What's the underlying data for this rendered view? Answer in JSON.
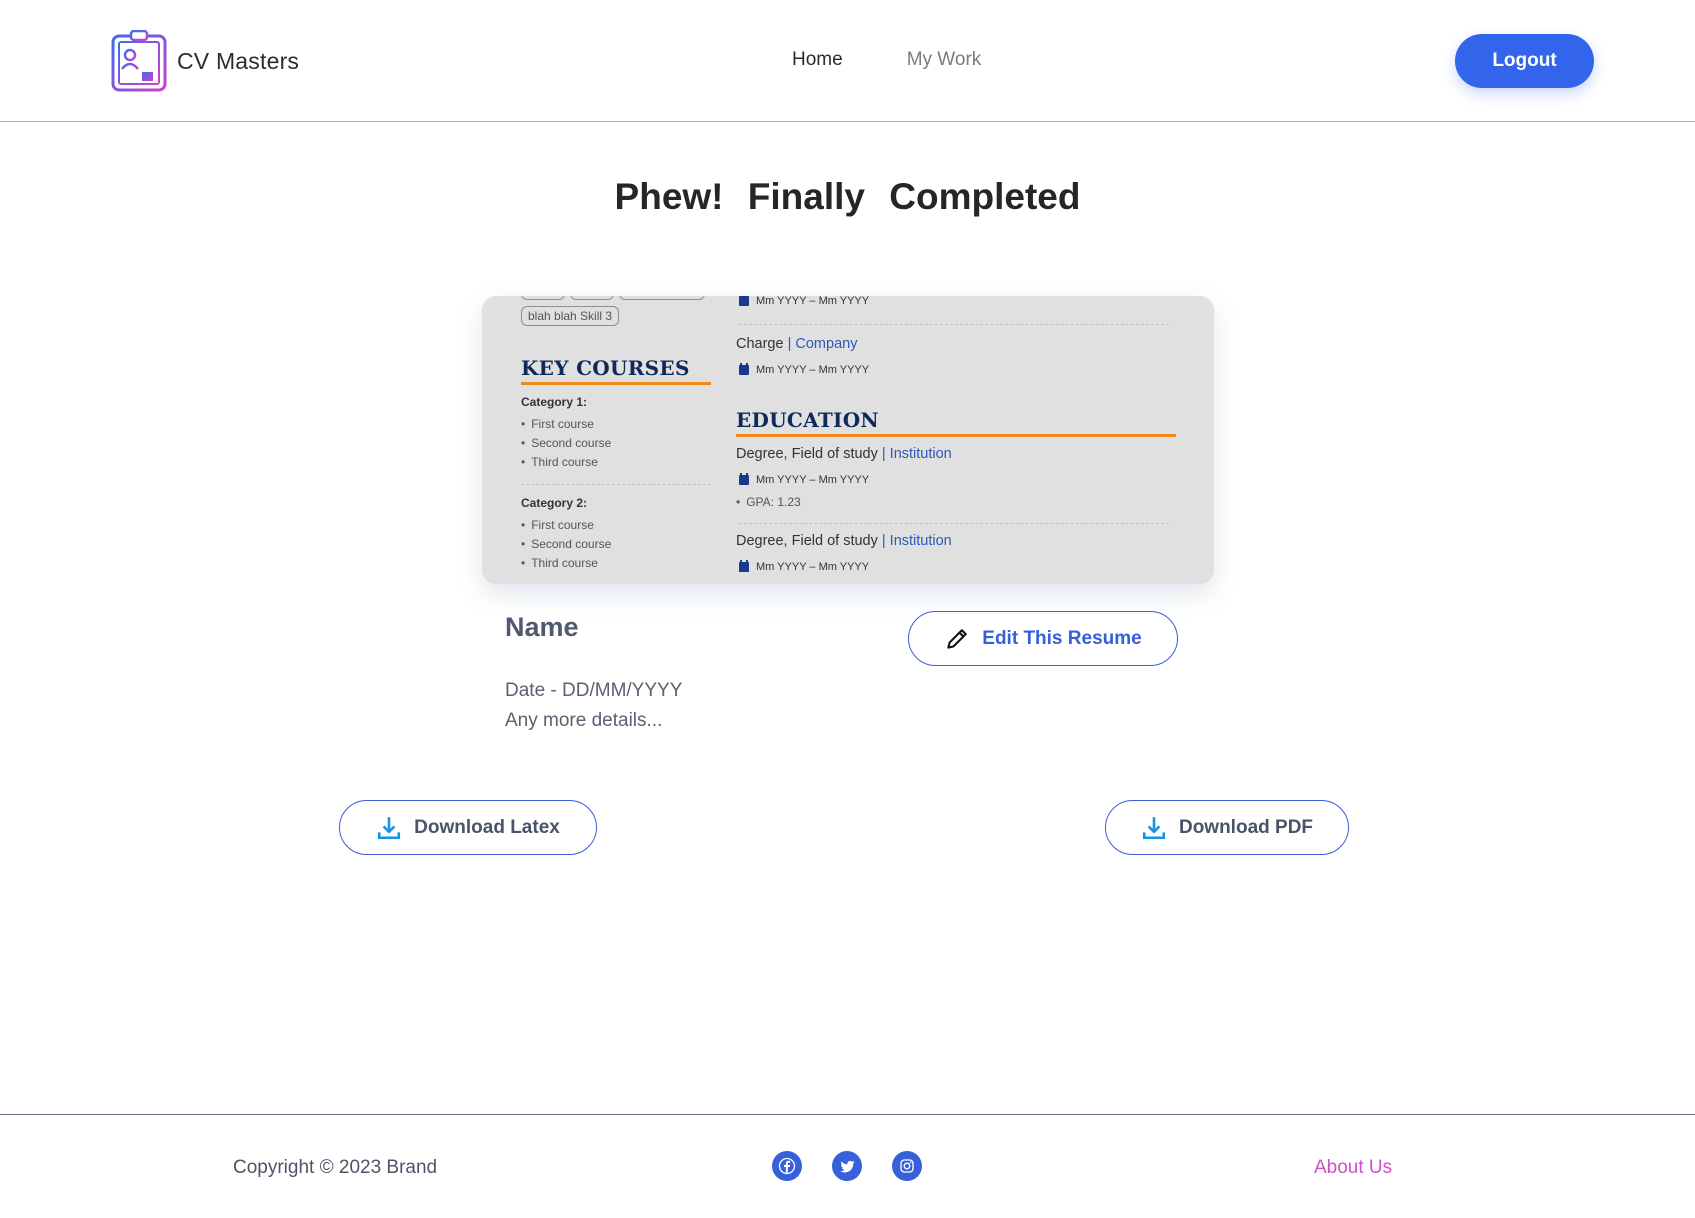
{
  "header": {
    "brand_name": "CV Masters",
    "nav": {
      "home": "Home",
      "my_work": "My Work"
    },
    "logout_label": "Logout"
  },
  "page_title": "Phew!   Finally Completed",
  "preview": {
    "skill_tag": "blah blah Skill 3",
    "key_courses_title": "KEY COURSES",
    "categories": [
      {
        "label": "Category 1:",
        "courses": [
          "First course",
          "Second course",
          "Third course"
        ]
      },
      {
        "label": "Category 2:",
        "courses": [
          "First course",
          "Second course",
          "Third course"
        ]
      }
    ],
    "top_date": "Mm YYYY – Mm YYYY",
    "experience": {
      "title": "Charge",
      "link": "| Company",
      "date": "Mm YYYY – Mm YYYY"
    },
    "education_title": "EDUCATION",
    "education": [
      {
        "title": "Degree, Field of study",
        "link": "| Institution",
        "date": "Mm YYYY – Mm YYYY",
        "gpa": "GPA: 1.23"
      },
      {
        "title": "Degree, Field of study",
        "link": "| Institution",
        "date": "Mm YYYY – Mm YYYY"
      }
    ],
    "colors": {
      "heading": "#0f2a5a",
      "accent": "#f08a1c",
      "link": "#2e57b8"
    }
  },
  "resume": {
    "name": "Name",
    "date": "Date - DD/MM/YYYY",
    "details": "Any more details...",
    "edit_label": "Edit This Resume"
  },
  "downloads": {
    "latex_label": "Download Latex",
    "pdf_label": "Download PDF"
  },
  "footer": {
    "copyright": "Copyright © 2023 Brand",
    "socials": [
      "facebook-icon",
      "twitter-icon",
      "instagram-icon"
    ],
    "about_label": "About Us"
  },
  "colors": {
    "primary": "#3364ec",
    "about_link": "#d04ec7"
  }
}
